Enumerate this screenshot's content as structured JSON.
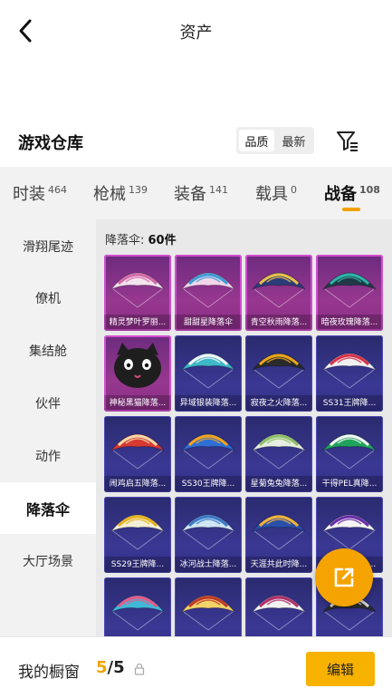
{
  "header": {
    "title": "资产"
  },
  "warehouse": {
    "title": "游戏仓库",
    "sort_options": [
      "品质",
      "最新"
    ],
    "active_sort": 0
  },
  "tabs": [
    {
      "label": "时装",
      "count": "464"
    },
    {
      "label": "枪械",
      "count": "139"
    },
    {
      "label": "装备",
      "count": "141"
    },
    {
      "label": "载具",
      "count": "0"
    },
    {
      "label": "战备",
      "count": "108",
      "active": true
    }
  ],
  "sidebar": {
    "items": [
      "滑翔尾迹",
      "僚机",
      "集结舱",
      "伙伴",
      "动作",
      "降落伞",
      "大厅场景"
    ],
    "active_index": 5
  },
  "content": {
    "count_prefix": "降落伞: ",
    "count_value": "60件"
  },
  "items": [
    {
      "name": "精灵梦叶罗丽...",
      "bg": "pink",
      "canopy": "#f3e4ee",
      "accent": "#d46aa8",
      "icon": "parachute-icon"
    },
    {
      "name": "甜甜星降落伞",
      "bg": "pink",
      "canopy": "#f2d6ea",
      "accent": "#3e9ed6",
      "icon": "parachute-icon"
    },
    {
      "name": "青空秋雨降落...",
      "bg": "pink",
      "canopy": "#2c3c78",
      "accent": "#e8c04a",
      "icon": "parachute-icon"
    },
    {
      "name": "暗夜玫瑰降落...",
      "bg": "pink",
      "canopy": "#1f3a46",
      "accent": "#2fb3a8",
      "icon": "parachute-icon"
    },
    {
      "name": "神秘黑猫降落...",
      "bg": "pink",
      "canopy": "#1e1e1e",
      "accent": "#d94a7a",
      "icon": "black-cat-parachute-icon"
    },
    {
      "name": "异域银装降落...",
      "bg": "blue",
      "canopy": "#3fb8c8",
      "accent": "#f4f4f4",
      "icon": "parachute-icon"
    },
    {
      "name": "寂夜之火降落...",
      "bg": "blue",
      "canopy": "#2a2a2a",
      "accent": "#e8a51c",
      "icon": "parachute-icon"
    },
    {
      "name": "SS31王牌降...",
      "bg": "blue",
      "canopy": "#f1f1f1",
      "accent": "#d8324a",
      "icon": "parachute-icon"
    },
    {
      "name": "闹鸡启五降落...",
      "bg": "blue",
      "canopy": "#d83a32",
      "accent": "#f4d8a8",
      "icon": "parachute-icon"
    },
    {
      "name": "SS30王牌降...",
      "bg": "blue",
      "canopy": "#2e6fd6",
      "accent": "#f4a21c",
      "icon": "parachute-icon"
    },
    {
      "name": "星菊兔兔降落...",
      "bg": "blue",
      "canopy": "#e8efe0",
      "accent": "#8fbf6a",
      "icon": "parachute-icon"
    },
    {
      "name": "干得PEL真降...",
      "bg": "blue",
      "canopy": "#1fa35c",
      "accent": "#f4f4f4",
      "icon": "parachute-icon"
    },
    {
      "name": "SS29王牌降...",
      "bg": "blue",
      "canopy": "#f4f0d8",
      "accent": "#e6b21e",
      "icon": "parachute-icon"
    },
    {
      "name": "冰河战士降落...",
      "bg": "blue",
      "canopy": "#cfe6f4",
      "accent": "#3a7ac8",
      "icon": "parachute-icon"
    },
    {
      "name": "天涯共此时降...",
      "bg": "blue",
      "canopy": "#2a4fa8",
      "accent": "#f2b23a",
      "icon": "parachute-icon"
    },
    {
      "name": "SS28王牌降...",
      "bg": "blue",
      "canopy": "#f4f4f4",
      "accent": "#6b2fa8",
      "icon": "parachute-icon"
    },
    {
      "name": "",
      "bg": "blue",
      "canopy": "#42b8d8",
      "accent": "#e85a8a",
      "icon": "parachute-icon"
    },
    {
      "name": "",
      "bg": "blue",
      "canopy": "#f2d36a",
      "accent": "#c0392b",
      "icon": "parachute-icon"
    },
    {
      "name": "",
      "bg": "blue",
      "canopy": "#f2f2f2",
      "accent": "#b0306a",
      "icon": "parachute-icon"
    },
    {
      "name": "",
      "bg": "blue",
      "canopy": "#2a2a2a",
      "accent": "#d0d0d0",
      "icon": "parachute-icon"
    }
  ],
  "footer": {
    "window_label": "我的橱窗",
    "window_current": "5",
    "window_sep_total": "/5",
    "edit_label": "编辑"
  },
  "colors": {
    "accent": "#f5a300",
    "edit_button": "#f7b200"
  }
}
